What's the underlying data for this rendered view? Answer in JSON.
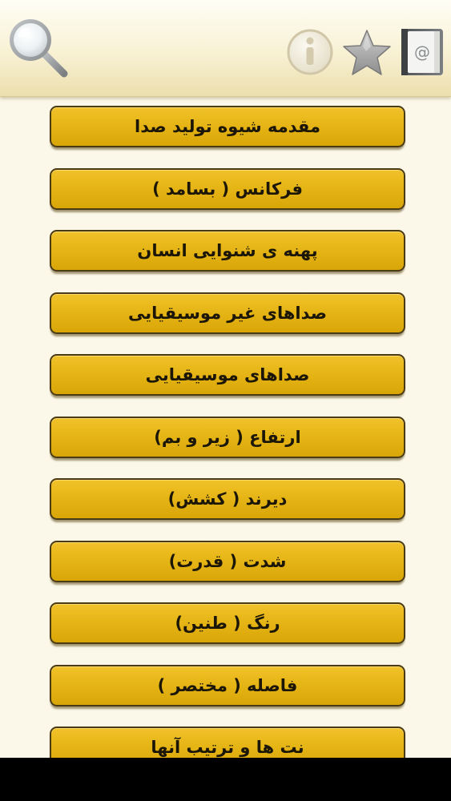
{
  "toolbar": {
    "icons": {
      "search": "search-icon",
      "info": "info-icon",
      "favorite": "star-icon",
      "contact": "address-book-icon"
    },
    "contact_symbol": "@"
  },
  "menu": {
    "items": [
      {
        "label": "مقدمه شیوه تولید صدا"
      },
      {
        "label": "فرکانس ( بسامد )"
      },
      {
        "label": "پهنه ی شنوایی انسان"
      },
      {
        "label": "صداهای غیر موسیقیایی"
      },
      {
        "label": "صداهای موسیقیایی"
      },
      {
        "label": "ارتفاع ( زیر و بم)"
      },
      {
        "label": "دیرند ( کشش)"
      },
      {
        "label": "شدت ( قدرت)"
      },
      {
        "label": "رنگ ( طنین)"
      },
      {
        "label": "فاصله ( مختصر )"
      },
      {
        "label": "نت ها و ترتیب آنها"
      }
    ]
  },
  "colors": {
    "toolbar_background": "#f8f1d4",
    "page_background": "#fbf8e9",
    "button_fill": "#e6b516",
    "button_border": "#4b3b14",
    "button_text": "#1b1606"
  }
}
